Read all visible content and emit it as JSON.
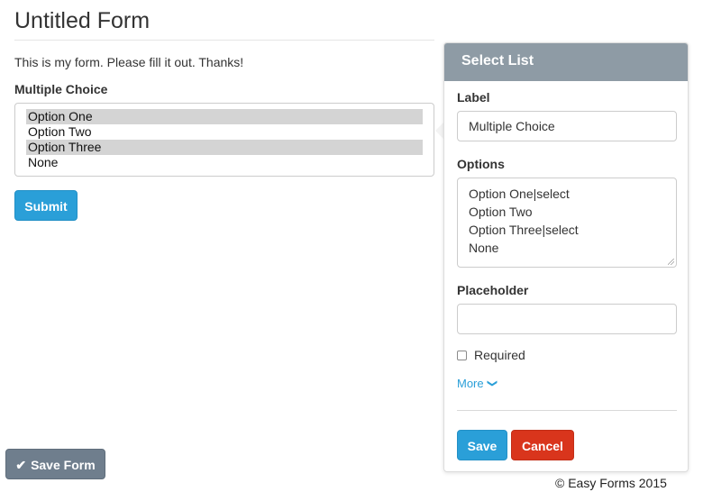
{
  "form": {
    "title": "Untitled Form",
    "description": "This is my form. Please fill it out. Thanks!",
    "field_label": "Multiple Choice",
    "options": [
      {
        "label": "Option One",
        "selected": true
      },
      {
        "label": "Option Two",
        "selected": false
      },
      {
        "label": "Option Three",
        "selected": true
      },
      {
        "label": "None",
        "selected": false
      }
    ],
    "submit_label": "Submit"
  },
  "panel": {
    "title": "Select List",
    "label_heading": "Label",
    "label_value": "Multiple Choice",
    "options_heading": "Options",
    "options_lines": [
      "Option One|select",
      "Option Two",
      "Option Three|select",
      "None"
    ],
    "placeholder_heading": "Placeholder",
    "placeholder_value": "",
    "required_label": "Required",
    "required_checked": false,
    "more_label": "More",
    "save_label": "Save",
    "cancel_label": "Cancel"
  },
  "toolbar": {
    "save_form_label": "Save Form"
  },
  "footer": {
    "text": "© Easy Forms 2015"
  },
  "icons": {
    "check": "check-icon",
    "chevron": "chevron-down-icon"
  },
  "colors": {
    "primary": "#2a9fd8",
    "danger": "#d9351c",
    "panel_header": "#8e9ba5",
    "save_form": "#6f7e8d",
    "selected_option": "#d4d4d4"
  }
}
